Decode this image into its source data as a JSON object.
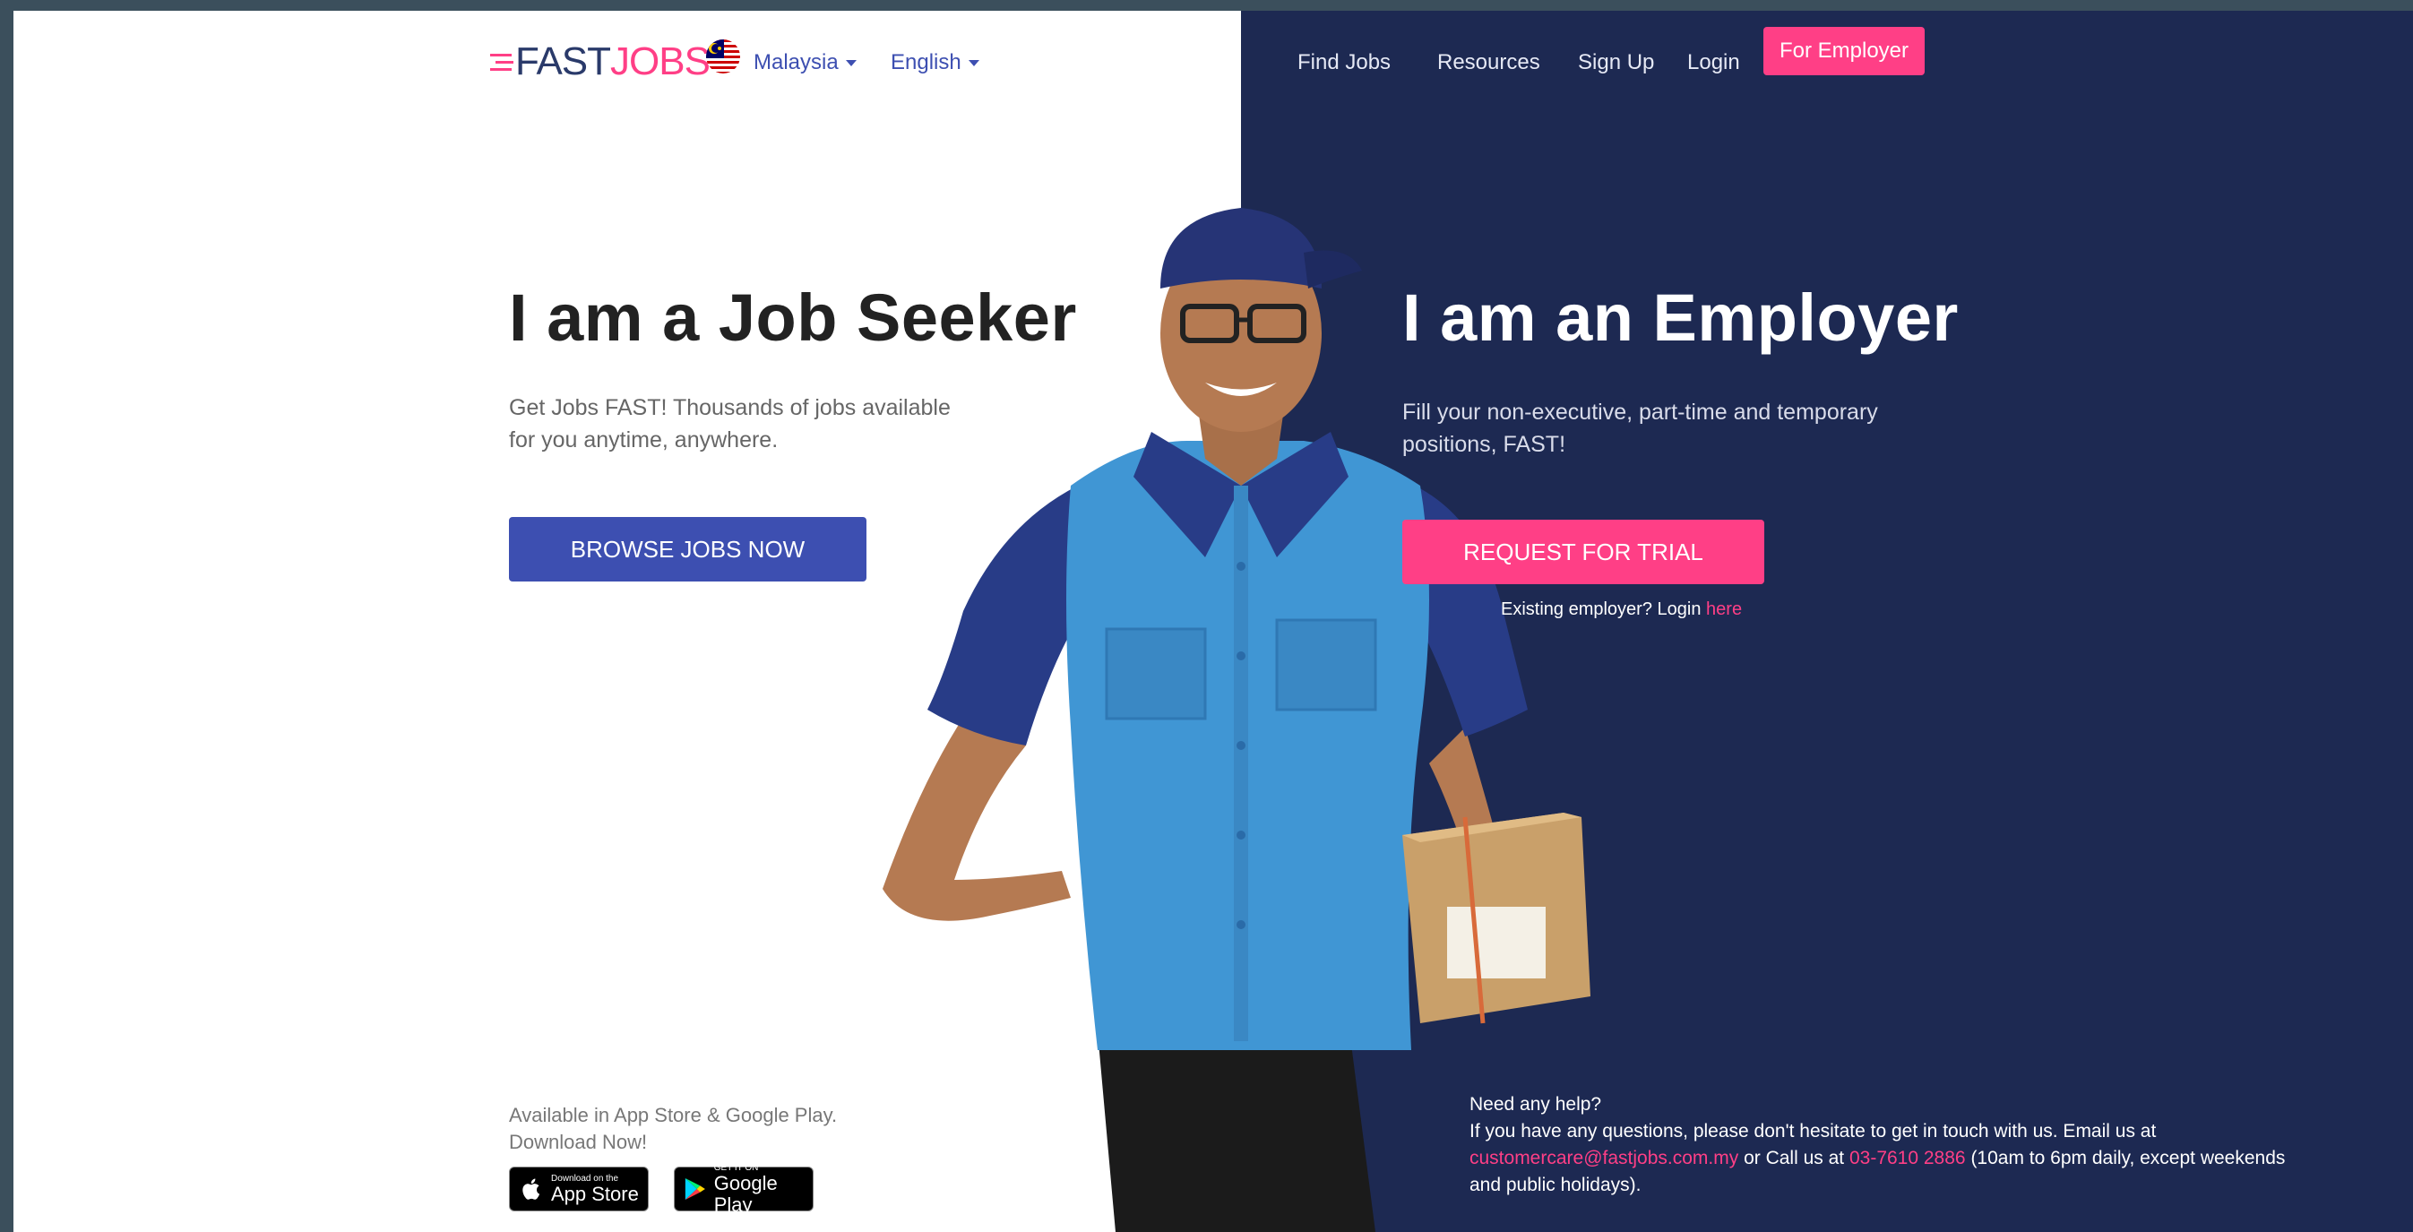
{
  "header": {
    "logo_text_left": "FAST",
    "logo_text_right": "JOBS",
    "country": "Malaysia",
    "language": "English",
    "nav": {
      "find_jobs": "Find Jobs",
      "resources": "Resources",
      "sign_up": "Sign Up",
      "login": "Login",
      "for_employer": "For Employer"
    }
  },
  "job_seeker": {
    "heading": "I am a Job Seeker",
    "description": "Get Jobs FAST! Thousands of jobs available for you anytime, anywhere.",
    "button": "BROWSE JOBS NOW",
    "app_availability_line1": "Available in App Store & Google Play.",
    "app_availability_line2": "Download Now!",
    "app_store_small": "Download on the",
    "app_store_big": "App Store",
    "google_play_small": "GET IT ON",
    "google_play_big": "Google Play"
  },
  "employer": {
    "heading": "I am an Employer",
    "description": "Fill your non-executive, part-time and temporary positions, FAST!",
    "button": "REQUEST FOR TRIAL",
    "existing_text": "Existing employer? Login",
    "existing_link": "here"
  },
  "help": {
    "title": "Need any help?",
    "line": "If you have any questions, please don't hesitate to get in touch with us. Email us at",
    "email": "customercare@fastjobs.com.my",
    "call_text": "or Call us at",
    "phone": "03-7610 2886",
    "hours": "(10am to 6pm daily, except weekends and public holidays)."
  },
  "colors": {
    "accent_pink": "#ff3f86",
    "primary_blue": "#3d4fb1",
    "navy_panel": "#1d2952"
  }
}
